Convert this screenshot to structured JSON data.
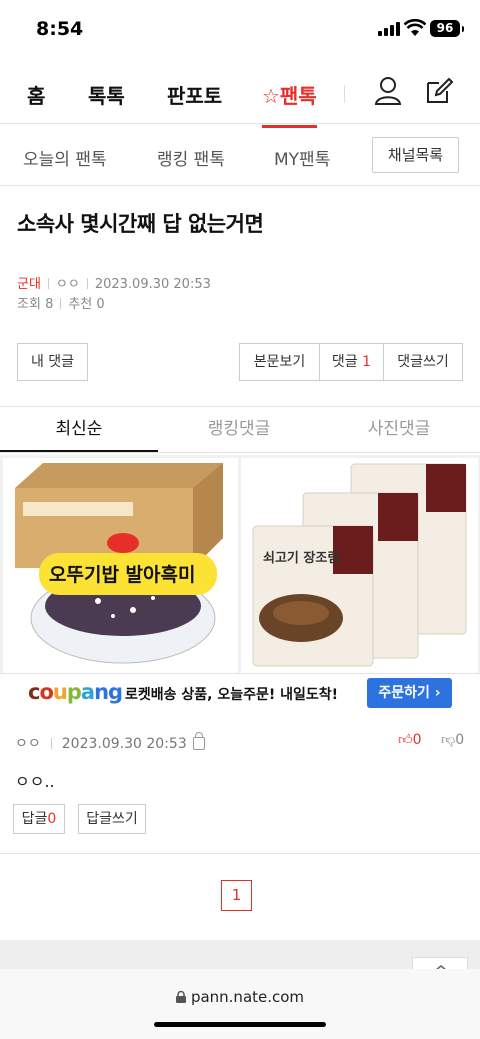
{
  "status": {
    "time": "8:54",
    "battery": "96"
  },
  "gnb": {
    "home": "홈",
    "toktok": "톡톡",
    "panpoto": "판포토",
    "pantok": "☆팬톡"
  },
  "subnav": {
    "today": "오늘의 팬톡",
    "ranking": "랭킹 팬톡",
    "my": "MY팬톡",
    "channel_button": "채널목록"
  },
  "post": {
    "title": "소속사 몇시간째 답 없는거면",
    "category": "군대",
    "author": "ㅇㅇ",
    "date": "2023.09.30 20:53",
    "views_label": "조회",
    "views": "8",
    "recommend_label": "추천",
    "recommend": "0"
  },
  "actions": {
    "my_comments": "내 댓글",
    "view_post": "본문보기",
    "comments_label": "댓글",
    "comments_count": "1",
    "write_comment": "댓글쓰기"
  },
  "tabs": [
    "최신순",
    "랭킹댓글",
    "사진댓글"
  ],
  "ad": {
    "left_product": "오뚜기밥 발아흑미",
    "right_product": "쇠고기 장조림",
    "logo": "coupang",
    "text": "로켓배송 상품, 오늘주문! 내일도착!",
    "button": "주문하기 ›"
  },
  "comment": {
    "author": "ㅇㅇ",
    "date": "2023.09.30 20:53",
    "likes": "0",
    "dislikes": "0",
    "text": "ㅇㅇ..",
    "reply_label": "답글",
    "reply_count": "0",
    "write_reply": "답글쓰기"
  },
  "pagination": {
    "current": "1"
  },
  "browser": {
    "url": "pann.nate.com"
  },
  "colors": {
    "accent": "#e5302a",
    "coupang_button": "#2c73e0"
  }
}
